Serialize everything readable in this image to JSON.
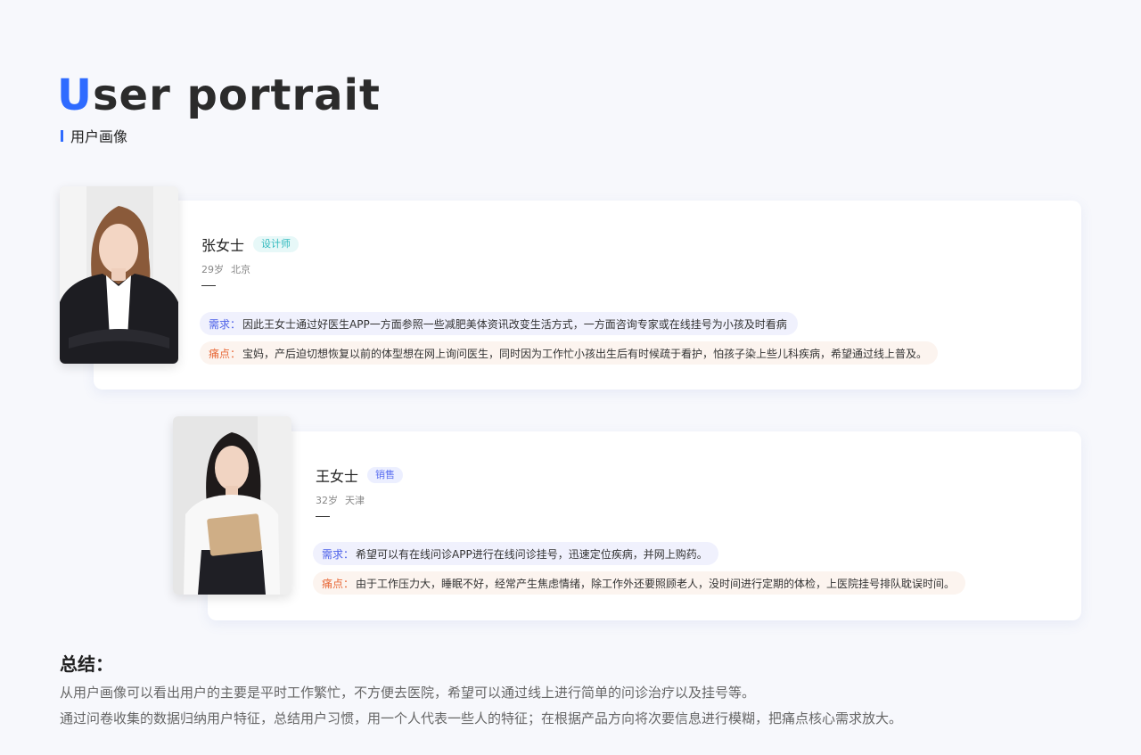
{
  "header": {
    "title_first_letter": "U",
    "title_rest": "ser portrait",
    "subtitle": "用户画像"
  },
  "colors": {
    "accent": "#2f6bff",
    "need_label": "#4a5ee8",
    "pain_label": "#e86a3a"
  },
  "personas": [
    {
      "name": "张女士",
      "tag": "设计师",
      "age": "29岁",
      "city": "北京",
      "need_label": "需求：",
      "need_text": "因此王女士通过好医生APP一方面参照一些减肥美体资讯改变生活方式，一方面咨询专家或在线挂号为小孩及时看病",
      "pain_label": "痛点：",
      "pain_text": "宝妈，产后迫切想恢复以前的体型想在网上询问医生，同时因为工作忙小孩出生后有时候疏于看护，怕孩子染上些儿科疾病，希望通过线上普及。"
    },
    {
      "name": "王女士",
      "tag": "销售",
      "age": "32岁",
      "city": "天津",
      "need_label": "需求：",
      "need_text": "希望可以有在线问诊APP进行在线问诊挂号，迅速定位疾病，并网上购药。",
      "pain_label": "痛点：",
      "pain_text": "由于工作压力大，睡眠不好，经常产生焦虑情绪，除工作外还要照顾老人，没时间进行定期的体检，上医院挂号排队耽误时间。"
    }
  ],
  "summary": {
    "title": "总结：",
    "lines": [
      "从用户画像可以看出用户的主要是平时工作繁忙，不方便去医院，希望可以通过线上进行简单的问诊治疗以及挂号等。",
      "通过问卷收集的数据归纳用户特征，总结用户习惯，用一个人代表一些人的特征；在根据产品方向将次要信息进行模糊，把痛点核心需求放大。"
    ]
  }
}
